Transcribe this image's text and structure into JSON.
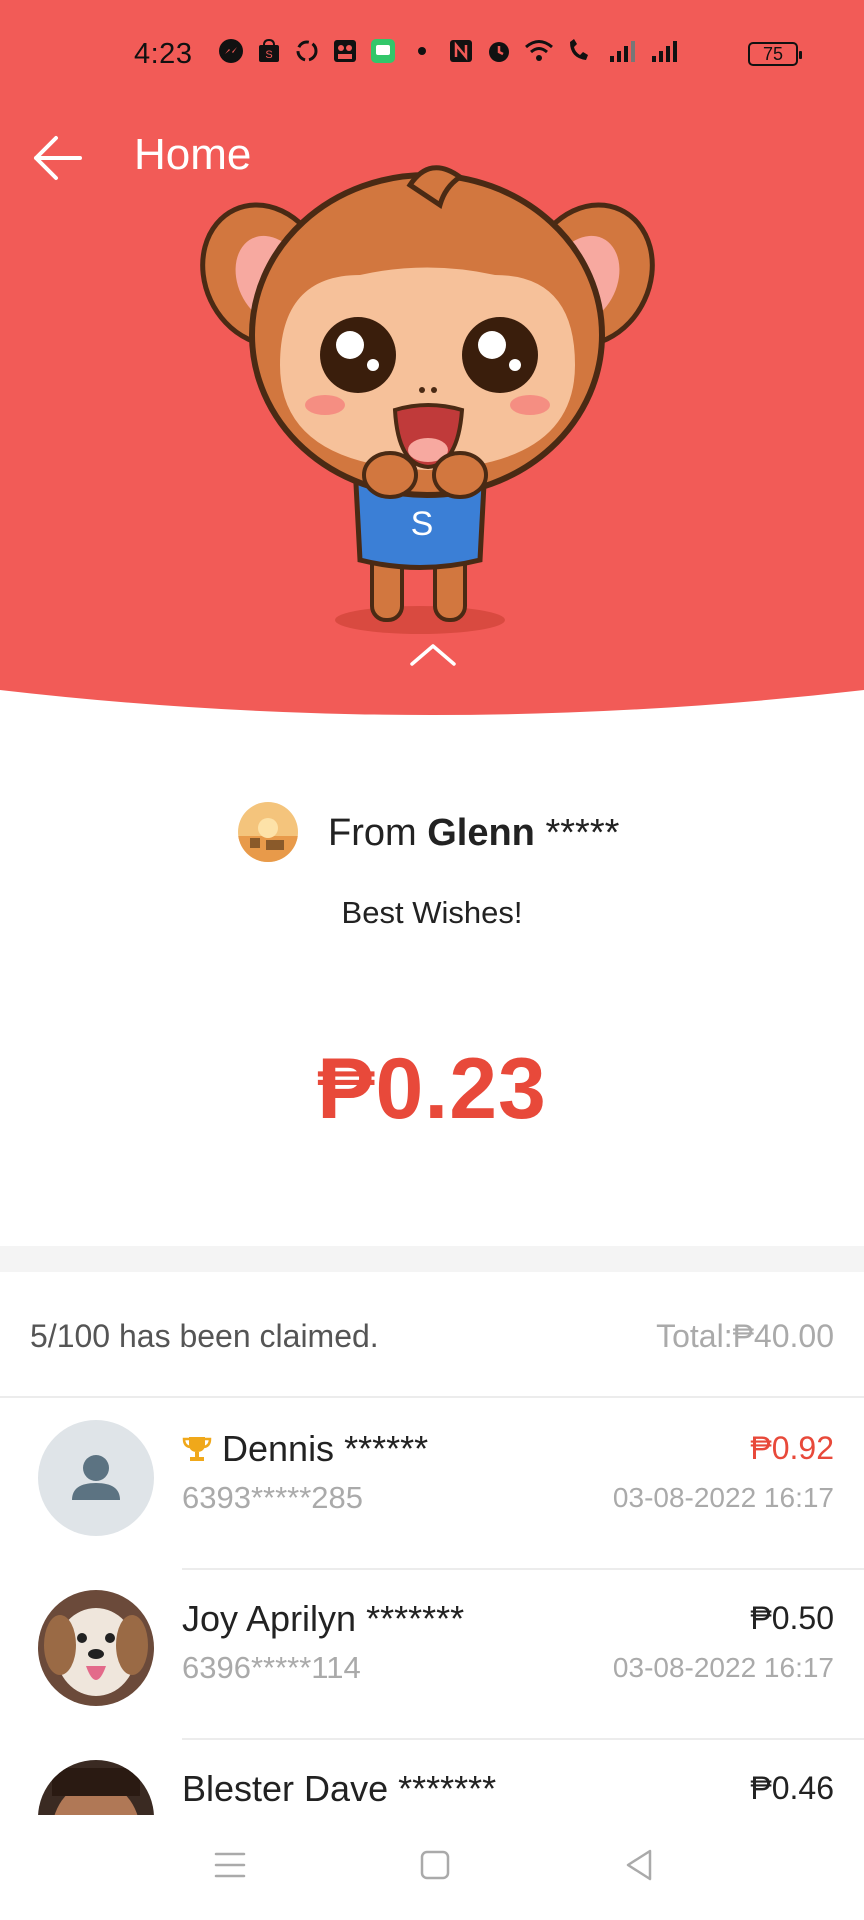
{
  "status_bar": {
    "time": "4:23",
    "battery": "75",
    "icons": [
      "messenger-icon",
      "shopee-icon",
      "sync-icon",
      "gallery-icon",
      "chat-icon",
      "dot",
      "nfc-icon",
      "alarm-icon",
      "wifi-icon",
      "wifi-call-icon",
      "signal-icon",
      "signal-icon"
    ]
  },
  "nav": {
    "title": "Home",
    "back_icon": "arrow-left-icon"
  },
  "hero": {
    "bg_color": "#F25B57",
    "mascot": "monkey-mascot",
    "expand_icon": "chevron-up-icon"
  },
  "sender": {
    "prefix": "From",
    "name": "Glenn",
    "masked": "*****"
  },
  "message": "Best Wishes!",
  "amount": "₱0.23",
  "summary": {
    "claimed": "5/100 has been claimed.",
    "total": "Total:₱40.00"
  },
  "claimers": [
    {
      "name": "Dennis ******",
      "phone": "6393*****285",
      "amount": "₱0.92",
      "date": "03-08-2022 16:17",
      "best": true,
      "avatar": "default-user-icon"
    },
    {
      "name": "Joy Aprilyn *******",
      "phone": "6396*****114",
      "amount": "₱0.50",
      "date": "03-08-2022 16:17",
      "best": false,
      "avatar": "dog-photo"
    },
    {
      "name": "Blester Dave *******",
      "phone": "",
      "amount": "₱0.46",
      "date": "",
      "best": false,
      "avatar": "person-photo"
    }
  ],
  "colors": {
    "accent_red": "#E8493A",
    "hero_red": "#F25B57"
  }
}
